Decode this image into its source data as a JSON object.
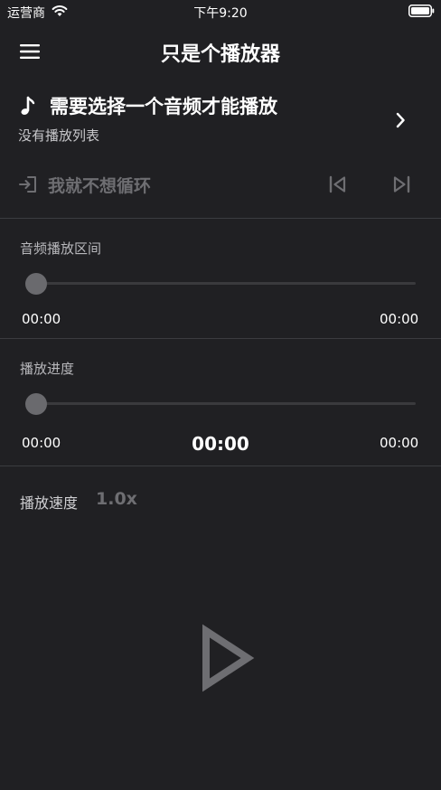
{
  "status_bar": {
    "carrier": "运营商",
    "time": "下午9:20"
  },
  "nav": {
    "title": "只是个播放器"
  },
  "track": {
    "title": "需要选择一个音频才能播放",
    "subtitle": "没有播放列表"
  },
  "loop": {
    "label": "我就不想循环"
  },
  "range": {
    "label": "音频播放区间",
    "start": "00:00",
    "end": "00:00",
    "position": 0
  },
  "progress": {
    "label": "播放进度",
    "start": "00:00",
    "current": "00:00",
    "end": "00:00",
    "position": 0
  },
  "speed": {
    "label": "播放速度",
    "value": "1.0x"
  },
  "colors": {
    "background": "#202023",
    "divider": "#3b3c40",
    "muted": "#6e6e72"
  },
  "icons": {
    "menu": "hamburger-menu-icon",
    "note": "music-note-icon",
    "chevron": "chevron-right-icon",
    "loop": "sign-in-icon",
    "prev": "skip-previous-icon",
    "next": "skip-next-icon",
    "play": "play-icon"
  }
}
